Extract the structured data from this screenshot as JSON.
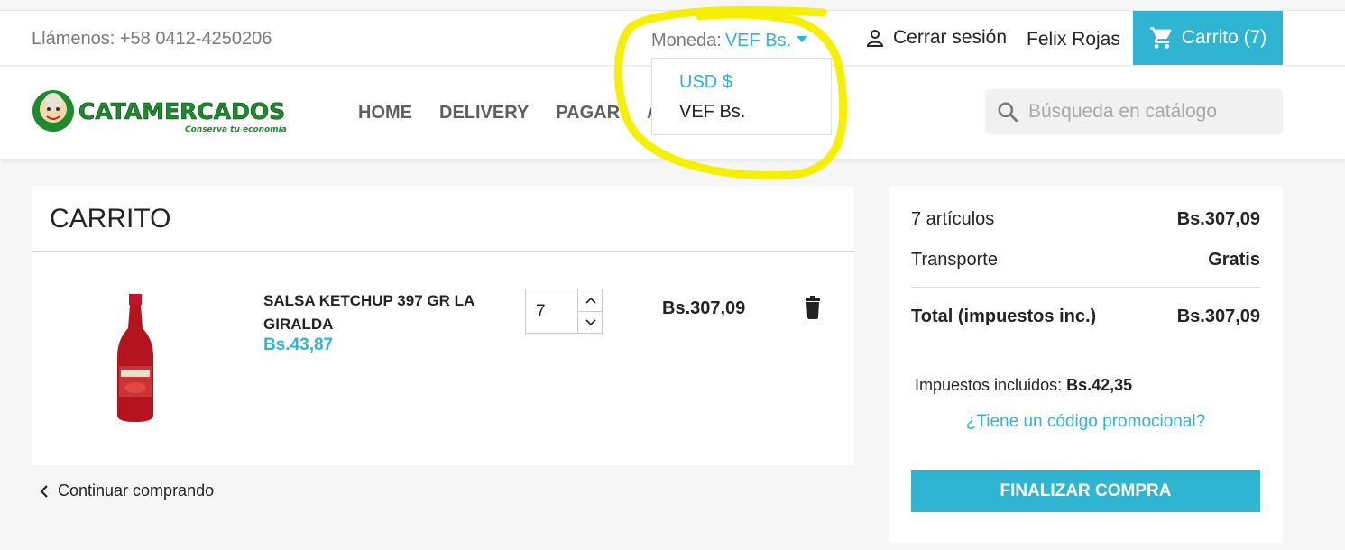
{
  "topbar": {
    "phone": "Llámenos: +58 0412-4250206",
    "currency_label": "Moneda:",
    "currency_value": "VEF Bs.",
    "logout": "Cerrar sesión",
    "user": "Felix Rojas",
    "cart": "Carrito (7)"
  },
  "currency_dropdown": {
    "options": [
      "USD $",
      "VEF Bs."
    ]
  },
  "header": {
    "logo_text": "CATAMERCADOS",
    "logo_tagline": "Conserva tu economía",
    "nav": [
      "HOME",
      "DELIVERY",
      "PAGAR",
      "AI"
    ],
    "search_placeholder": "Búsqueda en catálogo"
  },
  "cart": {
    "title": "CARRITO",
    "item": {
      "name": "SALSA KETCHUP 397 GR LA GIRALDA",
      "unit_price": "Bs.43,87",
      "quantity": "7",
      "line_total": "Bs.307,09"
    },
    "continue": "Continuar comprando"
  },
  "summary": {
    "items_label": "7 artículos",
    "items_value": "Bs.307,09",
    "shipping_label": "Transporte",
    "shipping_value": "Gratis",
    "total_label": "Total (impuestos inc.)",
    "total_value": "Bs.307,09",
    "taxes_label": "Impuestos incluidos:",
    "taxes_value": "Bs.42,35",
    "promo": "¿Tiene un código promocional?",
    "checkout": "FINALIZAR COMPRA"
  },
  "colors": {
    "accent": "#2fb5d2",
    "highlight": "#f5f000",
    "brand_green": "#1d8a2e"
  }
}
